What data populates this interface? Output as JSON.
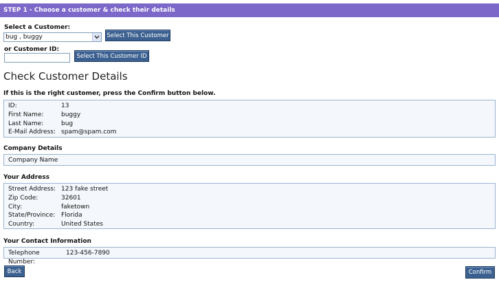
{
  "step": {
    "title": "STEP 1 - Choose a customer & check their details"
  },
  "customer_select": {
    "label": "Select a Customer:",
    "selected": "bug , buggy",
    "button": "Select This Customer"
  },
  "customer_id": {
    "label": "or Customer ID:",
    "value": "",
    "button": "Select This Customer ID"
  },
  "check": {
    "heading": "Check Customer Details",
    "instruction": "If this is the right customer, press the Confirm button below."
  },
  "customer_details": [
    {
      "label": "ID:",
      "value": "13"
    },
    {
      "label": "First Name:",
      "value": "buggy"
    },
    {
      "label": "Last Name:",
      "value": "bug"
    },
    {
      "label": "E-Mail Address:",
      "value": "spam@spam.com"
    }
  ],
  "company": {
    "heading": "Company Details",
    "name": "Company Name"
  },
  "address": {
    "heading": "Your Address",
    "rows": [
      {
        "label": "Street Address:",
        "value": "123 fake street"
      },
      {
        "label": "Zip Code:",
        "value": "32601"
      },
      {
        "label": "City:",
        "value": "faketown"
      },
      {
        "label": "State/Province:",
        "value": "Florida"
      },
      {
        "label": "Country:",
        "value": "United States"
      }
    ]
  },
  "contact": {
    "heading": "Your Contact Information",
    "rows": [
      {
        "label": "Telephone Number:",
        "value": "123-456-7890"
      }
    ]
  },
  "actions": {
    "back": "Back",
    "confirm": "Confirm"
  },
  "colors": {
    "step_bar": "#7b68c9",
    "button": "#3c6190",
    "box_border": "#9ab3cf",
    "box_bg": "#f4f7fb"
  }
}
